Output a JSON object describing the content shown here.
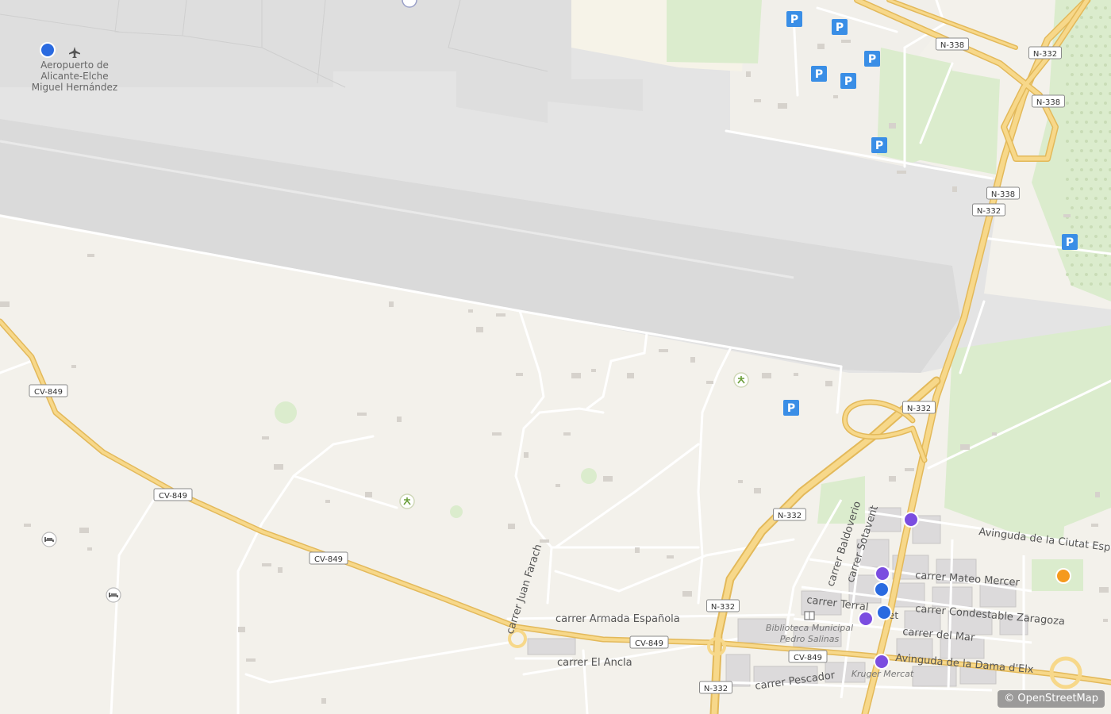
{
  "attribution": "© OpenStreetMap",
  "places": {
    "airport": [
      "Aeropuerto de",
      "Alicante-Elche",
      "Miguel Hernández"
    ],
    "library": [
      "Biblioteca Municipal",
      "Pedro Salinas"
    ],
    "market": "Kruger Mercat",
    "cut_label": "et"
  },
  "roads": {
    "cv849_badges": [
      "CV-849",
      "CV-849",
      "CV-849",
      "CV-849",
      "CV-849"
    ],
    "n332_badges": [
      "N-332",
      "N-332",
      "N-332",
      "N-332",
      "N-332",
      "N-332"
    ],
    "n338_badges": [
      "N-338",
      "N-338",
      "N-338"
    ]
  },
  "streets": [
    "carrer Armada Española",
    "carrer El Ancla",
    "carrer Juan Farach",
    "carrer Pescador",
    "carrer Mateo Mercer",
    "carrer Condestable Zaragoza",
    "carrer del Mar",
    "Avinguda de la Dama d'Elx",
    "carrer Terral",
    "carrer Baldoverio",
    "carrer Sotavent",
    "Avinguda de la Ciutat Esportiva"
  ],
  "icons": {
    "parking": "P",
    "airport": "airplane-icon",
    "playground": "playground-icon",
    "hotel": "bed-icon",
    "library": "book-icon"
  },
  "colors": {
    "land": "#f3f1eb",
    "airport_area": "#e6e6e6",
    "runway": "#dcdcdc",
    "green": "#dbeccd",
    "motorway": "#f7d88a",
    "motorway_casing": "#e3b95a",
    "parking": "#3a8ee6",
    "marker_blue": "#2a6ae0",
    "marker_purple": "#7b4de0",
    "marker_orange": "#f59a1e"
  }
}
